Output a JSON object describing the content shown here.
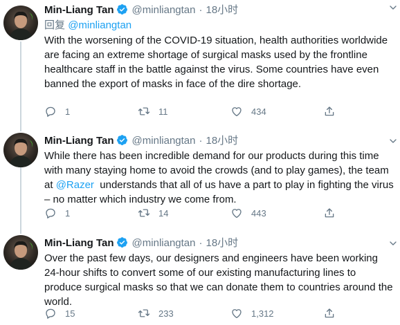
{
  "author": {
    "name": "Min-Liang Tan",
    "handle": "@minliangtan"
  },
  "colors": {
    "text": "#14171a",
    "secondary": "#657786",
    "link": "#1da1f2",
    "thread_line": "#ccd6dd"
  },
  "tweets": [
    {
      "time": "18小时",
      "reply_prefix": "回复",
      "reply_to": "@minliangtan",
      "text": "With the worsening of the COVID-19 situation, health authorities worldwide are facing an extreme shortage of surgical masks used by the frontline healthcare staff in the battle against the virus. Some countries have even banned the export of masks in face of the dire shortage.",
      "replies": "1",
      "retweets": "11",
      "likes": "434"
    },
    {
      "time": "18小时",
      "text_before": "While there has been incredible demand for our products during this time with many staying home to avoid the crowds (and to play games), the team at ",
      "text_mention": "@Razer",
      "text_after": "  understands that all of us have a part to play in fighting the virus – no matter which industry we come from.",
      "replies": "1",
      "retweets": "14",
      "likes": "443"
    },
    {
      "time": "18小时",
      "text": "Over the past few days, our designers and engineers have been working 24-hour shifts to convert some of our existing manufacturing lines to produce surgical masks so that we can donate them to countries around the world.",
      "replies": "15",
      "retweets": "233",
      "likes": "1,312"
    }
  ],
  "icons": {
    "verified": "verified-badge-icon",
    "more": "chevron-down-icon",
    "reply": "reply-icon",
    "retweet": "retweet-icon",
    "like": "heart-icon",
    "share": "share-icon"
  }
}
